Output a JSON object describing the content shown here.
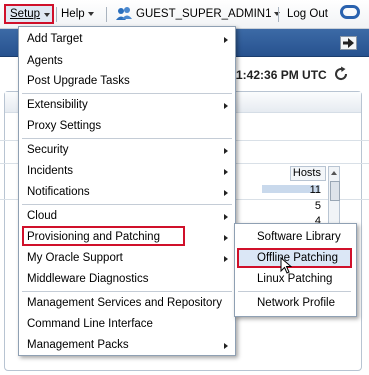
{
  "topbar": {
    "setup_label": "Setup",
    "help_label": "Help",
    "user_label": "GUEST_SUPER_ADMIN1",
    "logout_label": "Log Out",
    "icons": [
      "chevron-down-icon",
      "user-icon",
      "oracle-logo-icon"
    ]
  },
  "page": {
    "time_text": "11:42:36 PM UTC",
    "hosts_header": "Hosts",
    "hosts_values": [
      "11",
      "5",
      "4"
    ]
  },
  "setup_menu": {
    "items": [
      {
        "label": "Add Target"
      },
      {
        "label": "Agents"
      },
      {
        "label": "Post Upgrade Tasks"
      },
      {
        "label": "Extensibility"
      },
      {
        "label": "Proxy Settings"
      },
      {
        "label": "Security"
      },
      {
        "label": "Incidents"
      },
      {
        "label": "Notifications"
      },
      {
        "label": "Cloud"
      },
      {
        "label": "Provisioning and Patching"
      },
      {
        "label": "My Oracle Support"
      },
      {
        "label": "Middleware Diagnostics"
      },
      {
        "label": "Management Services and Repository"
      },
      {
        "label": "Command Line Interface"
      },
      {
        "label": "Management Packs"
      }
    ]
  },
  "submenu": {
    "items": [
      {
        "label": "Software Library"
      },
      {
        "label": "Offline Patching"
      },
      {
        "label": "Linux Patching"
      },
      {
        "label": "Network Profile"
      }
    ]
  },
  "colors": {
    "highlight_border": "#d0102a",
    "band": "#2f5d9a",
    "hover_bg": "#dbe7f6"
  }
}
